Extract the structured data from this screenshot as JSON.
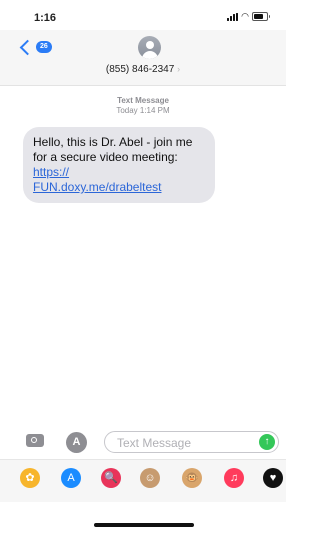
{
  "status": {
    "time": "1:16"
  },
  "header": {
    "back_badge": "26",
    "contact": "(855) 846-2347",
    "contact_chevron": "›"
  },
  "thread": {
    "label": "Text Message",
    "timestamp": "Today 1:14 PM"
  },
  "message": {
    "text": "Hello, this is Dr. Abel - join me for a secure video meeting:",
    "link_line1": "https://",
    "link_line2": "FUN.doxy.me/drabeltest"
  },
  "input": {
    "placeholder": "Text Message"
  },
  "apps": [
    {
      "name": "photos-app-icon",
      "glyph": "✿",
      "color": "#f7b52c"
    },
    {
      "name": "app-store-app-icon",
      "glyph": "A",
      "color": "#1b8cff"
    },
    {
      "name": "images-search-app-icon",
      "glyph": "🔍",
      "color": "#e8345a"
    },
    {
      "name": "memoji-app-icon",
      "glyph": "☺",
      "color": "#c79b6f"
    },
    {
      "name": "animoji-app-icon",
      "glyph": "🐵",
      "color": "#d9a56b"
    },
    {
      "name": "music-app-icon",
      "glyph": "♫",
      "color": "#ff3b5c"
    },
    {
      "name": "digital-touch-app-icon",
      "glyph": "♥",
      "color": "#111111"
    }
  ]
}
